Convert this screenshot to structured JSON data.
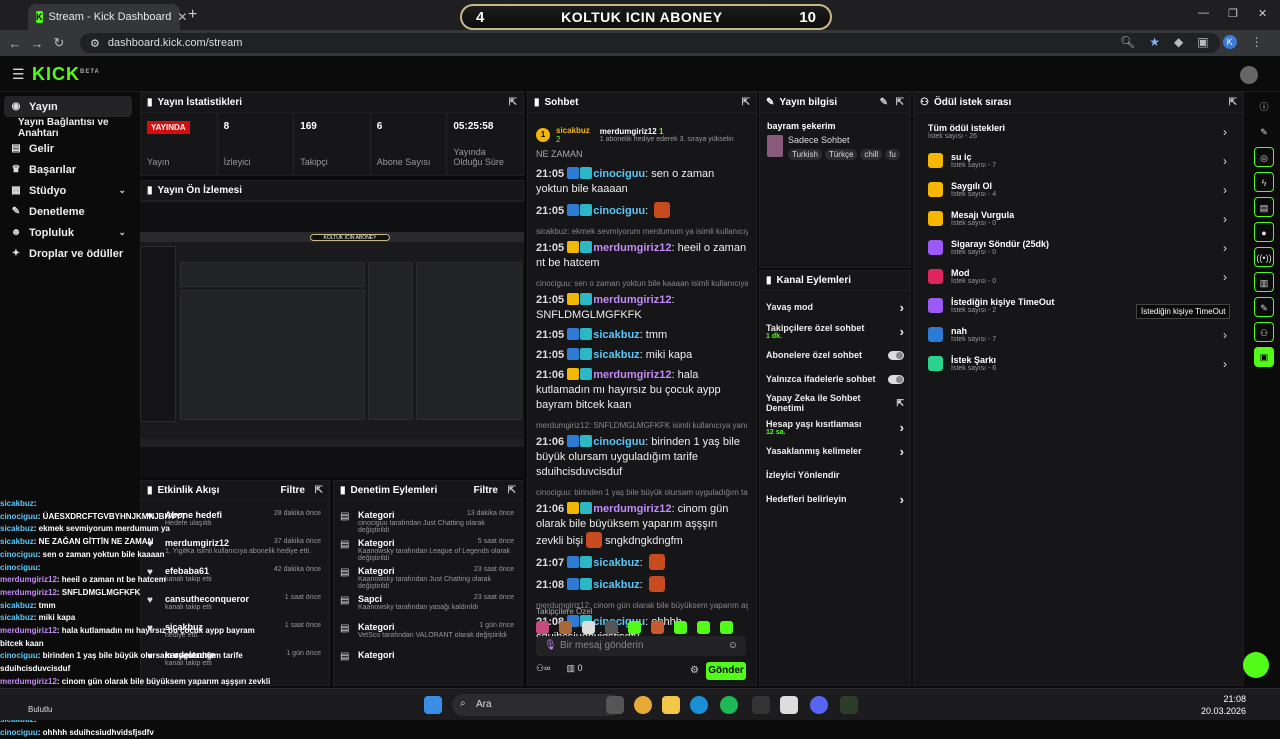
{
  "browser": {
    "tab_title": "Stream - Kick Dashboard",
    "url": "dashboard.kick.com/stream",
    "profile_initial": "K"
  },
  "overlay": {
    "left_num": "4",
    "label": "KOLTUK ICIN ABONEY",
    "right_num": "10"
  },
  "kick": {
    "logo": "KICK",
    "logo_sup": "BETA"
  },
  "sidebar": {
    "items": [
      {
        "label": "Yayın",
        "icon": "broadcast-icon"
      },
      {
        "label": "Yayın Bağlantısı ve Anahtarı"
      },
      {
        "label": "Gelir",
        "icon": "money-icon"
      },
      {
        "label": "Başarılar",
        "icon": "trophy-icon"
      },
      {
        "label": "Stüdyo",
        "icon": "studio-icon"
      },
      {
        "label": "Denetleme",
        "icon": "wrench-icon"
      },
      {
        "label": "Topluluk",
        "icon": "people-icon"
      },
      {
        "label": "Droplar ve ödüller",
        "icon": "gift-icon"
      }
    ]
  },
  "stats": {
    "title": "Yayın İstatistikleri",
    "live_badge": "YAYINDA",
    "items": [
      {
        "value": "",
        "label": "Yayın"
      },
      {
        "value": "8",
        "label": "İzleyici"
      },
      {
        "value": "169",
        "label": "Takipçi"
      },
      {
        "value": "6",
        "label": "Abone Sayısı"
      },
      {
        "value": "05:25:58",
        "label": "Yayında Olduğu Süre"
      }
    ]
  },
  "preview": {
    "title": "Yayın Ön İzlemesi",
    "overlay_label": "KOLTUK ICIN ABONEY"
  },
  "chat": {
    "title": "Sohbet",
    "pinned": {
      "user1": "sicakbuz",
      "user1_count": "2",
      "user2": "merdumgiriz12",
      "user2_count": "1",
      "note": "1 abonelik hediye ederek 3. sıraya yükselin"
    },
    "partial_top": "NE ZAMAN",
    "messages": [
      {
        "time": "21:05",
        "user": "cinociguu",
        "text": "sen o zaman yoktun bile kaaaan",
        "reply": ""
      },
      {
        "time": "21:05",
        "user": "cinociguu",
        "text": "",
        "reply": "",
        "emote": true
      },
      {
        "time": "21:05",
        "user": "merdumgiriz12",
        "text": "heeil o zaman nt be hatcem",
        "reply": "sicakbuz: ekmek sevmiyorum merdumum ya isimli kullanıcıya ...",
        "color": "purple"
      },
      {
        "time": "21:05",
        "user": "merdumgiriz12",
        "text": "SNFLDMGLMGFKFK",
        "reply": "cinociguu: sen o zaman yoktun bile kaaaan isimli kullanıcıya ya...",
        "color": "purple"
      },
      {
        "time": "21:05",
        "user": "sicakbuz",
        "text": "tmm",
        "reply": ""
      },
      {
        "time": "21:05",
        "user": "sicakbuz",
        "text": "miki kapa",
        "reply": ""
      },
      {
        "time": "21:06",
        "user": "merdumgiriz12",
        "text": "hala kutlamadın mı hayırsız bu çocuk aypp bayram bitcek kaan",
        "reply": "",
        "color": "purple"
      },
      {
        "time": "21:06",
        "user": "cinociguu",
        "text": "birinden 1 yaş bile büyük olursam uyguladığım tarife sduihcisduvcisduf",
        "reply": "merdumgiriz12: SNFLDMGLMGFKFK isimli kullanıcıya yanıt veri..."
      },
      {
        "time": "21:06",
        "user": "merdumgiriz12",
        "text": "cinom gün olarak bile büyüksem yaparım aşşşırı zevkli bişi",
        "tail": "sngkdngkdngfm",
        "reply": "cinociguu: birinden 1 yaş bile büyük olursam uyguladığım tarife ...",
        "color": "purple",
        "emote": true
      },
      {
        "time": "21:07",
        "user": "sicakbuz",
        "text": "",
        "reply": "",
        "emote": true
      },
      {
        "time": "21:08",
        "user": "sicakbuz",
        "text": "",
        "reply": "",
        "emote": true
      },
      {
        "time": "21:08",
        "user": "cinociguu",
        "text": "ohhhh sduihcsiudhvidsfjsdfv",
        "reply": "merdumgiriz12: cinom gün olarak bile büyüksem yaparım aşşşırı zevkli ..."
      }
    ],
    "followers_only": "Takipçilere Özel",
    "input_placeholder": "Bir mesaj gönderin",
    "counter": "0",
    "send": "Gönder"
  },
  "stream_info": {
    "title": "Yayın bilgisi",
    "stream_title": "bayram şekerim",
    "category": "Sadece Sohbet",
    "tags": [
      "Turkish",
      "Türkçe",
      "chill",
      "fu"
    ]
  },
  "channel_actions": {
    "title": "Kanal Eylemleri",
    "items": [
      {
        "label": "Yavaş mod",
        "sub": "",
        "kind": "chevron"
      },
      {
        "label": "Takipçilere özel sohbet",
        "sub": "1 dk.",
        "kind": "chevron"
      },
      {
        "label": "Abonelere özel sohbet",
        "sub": "",
        "kind": "toggle"
      },
      {
        "label": "Yalnızca ifadelerle sohbet",
        "sub": "",
        "kind": "toggle"
      },
      {
        "label": "Yapay Zeka ile Sohbet Denetimi",
        "sub": "",
        "kind": "external"
      },
      {
        "label": "Hesap yaşı kısıtlaması",
        "sub": "12 sa.",
        "kind": "chevron"
      },
      {
        "label": "Yasaklanmış kelimeler",
        "sub": "",
        "kind": "chevron"
      },
      {
        "label": "İzleyici Yönlendir",
        "sub": "",
        "kind": "none"
      },
      {
        "label": "Hedefleri belirleyin",
        "sub": "",
        "kind": "chevron"
      }
    ]
  },
  "rewards": {
    "title": "Ödül istek sırası",
    "all": {
      "label": "Tüm ödül istekleri",
      "sub": "İstek sayısı - 26"
    },
    "items": [
      {
        "label": "su iç",
        "sub": "İstek sayısı - 7",
        "color": "#f5b700"
      },
      {
        "label": "Saygılı Ol",
        "sub": "İstek sayısı - 4",
        "color": "#f5b700"
      },
      {
        "label": "Mesajı Vurgula",
        "sub": "İstek sayısı - 0",
        "color": "#f5b700"
      },
      {
        "label": "Sigarayı Söndür (25dk)",
        "sub": "İstek sayısı - 0",
        "color": "#9b59f5"
      },
      {
        "label": "Mod",
        "sub": "İstek sayısı - 0",
        "color": "#e0245e"
      },
      {
        "label": "İstediğin kişiye TimeOut",
        "sub": "İstek sayısı - 2",
        "color": "#9b59f5"
      },
      {
        "label": "nah",
        "sub": "İstek sayısı - 7",
        "color": "#2d7bd4"
      },
      {
        "label": "İstek Şarkı",
        "sub": "İstek sayısı - 6",
        "color": "#2bd48e"
      }
    ],
    "tooltip": "İstediğin kişiye TimeOut"
  },
  "activity": {
    "title": "Etkinlik Akışı",
    "filter": "Filtre",
    "items": [
      {
        "name": "Abone hedefi",
        "sub": "Hedefe ulaşıldı",
        "time": "28 dakika önce"
      },
      {
        "name": "merdumgiriz12",
        "sub": "1, YigitKa isimli kullanıcıya abonelik hediye etti.",
        "time": "37 dakika önce"
      },
      {
        "name": "efebaba61",
        "sub": "kanalı takip etti",
        "time": "42 dakika önce"
      },
      {
        "name": "cansutheconqueror",
        "sub": "kanalı takip etti",
        "time": "1 saat önce"
      },
      {
        "name": "sicakbuz",
        "sub": "hediye etti.",
        "time": "1 saat önce"
      },
      {
        "name": "kardelenme",
        "sub": "kanalı takip etti",
        "time": "1 gün önce"
      }
    ]
  },
  "moderation": {
    "title": "Denetim Eylemleri",
    "filter": "Filtre",
    "items": [
      {
        "name": "Kategori",
        "sub": "cinociguu tarafından Just Chatting olarak değiştirildi",
        "time": "13 dakika önce"
      },
      {
        "name": "Kategori",
        "sub": "Kaanowsky tarafından League of Legends olarak değiştirildi",
        "time": "5 saat önce"
      },
      {
        "name": "Kategori",
        "sub": "Kaanowsky tarafından Just Chatting olarak değiştirildi",
        "time": "23 saat önce"
      },
      {
        "name": "Sapci",
        "sub": "Kaanowsky tarafından yasağı kaldırıldı",
        "time": "23 saat önce"
      },
      {
        "name": "Kategori",
        "sub": "VetSco tarafından VALORANT olarak değiştirildi",
        "time": "1 gün önce"
      },
      {
        "name": "Kategori",
        "sub": "",
        "time": ""
      }
    ]
  },
  "left_chat": [
    {
      "u": "sicakbuz",
      "t": ":"
    },
    {
      "u": "cinociguu",
      "t": ": ÜAESXDRCFTGVBYHNJKMNJBHVYT"
    },
    {
      "u": "sicakbuz",
      "t": ": ekmek sevmiyorum merdumum ya"
    },
    {
      "u": "sicakbuz",
      "t": ": NE ZAĞAN GİTTİN NE ZAMAN"
    },
    {
      "u": "cinociguu",
      "t": ": sen o zaman yoktun bile kaaaan"
    },
    {
      "u": "cinociguu",
      "t": ":"
    },
    {
      "u": "merdumgiriz12",
      "t": ": heeil o zaman nt be hatcem"
    },
    {
      "u": "merdumgiriz12",
      "t": ": SNFLDMGLMGFKFK"
    },
    {
      "u": "sicakbuz",
      "t": ": tmm"
    },
    {
      "u": "sicakbuz",
      "t": ": miki kapa"
    },
    {
      "u": "merdumgiriz12",
      "t": ": hala kutlamadın mı hayırsız bu çocuk aypp bayram bitcek kaan"
    },
    {
      "u": "cinociguu",
      "t": ": birinden 1 yaş bile büyük olursam uyguladığım tarife sduihcisduvcisduf"
    },
    {
      "u": "merdumgiriz12",
      "t": ": cinom gün olarak bile büyüksem yaparım aşşşırı zevkli bişi sngkdngkdngfm"
    },
    {
      "u": "sicakbuz",
      "t": ":"
    },
    {
      "u": "sicakbuz",
      "t": ":"
    },
    {
      "u": "cinociguu",
      "t": ": ohhhh sduihcsiudhvidsfjsdfv"
    }
  ],
  "taskbar": {
    "search": "Ara",
    "time": "21:08",
    "date": "20.03.2026",
    "weather": "Bulutlu"
  }
}
